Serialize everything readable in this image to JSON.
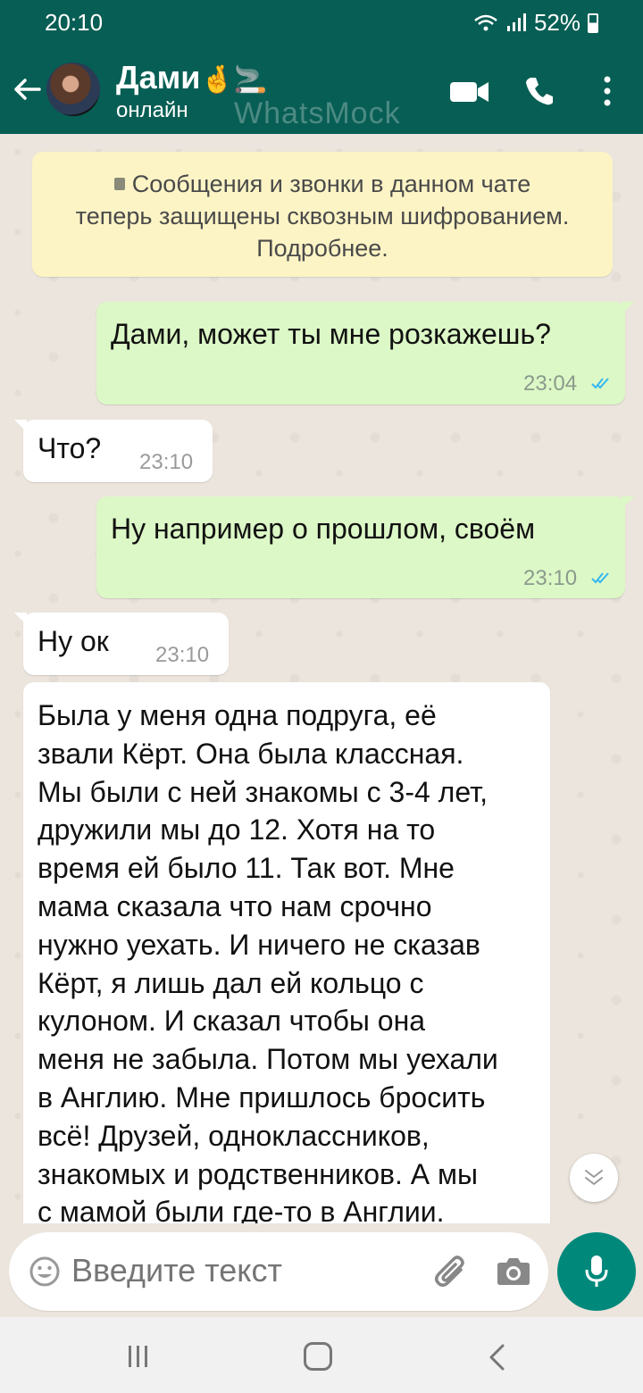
{
  "status_bar": {
    "time": "20:10",
    "battery": "52%"
  },
  "header": {
    "contact_name": "Дами",
    "contact_emoji": "🤞🚬",
    "contact_status": "онлайн",
    "watermark": "WhatsMock"
  },
  "system_message": {
    "line1": "Сообщения и звонки в данном чате",
    "line2": "теперь защищены сквозным шифрованием.",
    "line3": "Подробнее."
  },
  "messages": [
    {
      "direction": "out",
      "text": "Дами, может ты мне розкажешь?",
      "time": "23:04",
      "read": true
    },
    {
      "direction": "in",
      "text": "Что?",
      "time": "23:10"
    },
    {
      "direction": "out",
      "text": "Ну например о прошлом, своём",
      "time": "23:10",
      "read": true
    },
    {
      "direction": "in",
      "text": "Ну ок",
      "time": "23:10"
    },
    {
      "direction": "in",
      "lines": [
        "Была у меня одна подруга, её",
        "звали Кёрт. Она была классная.",
        "Мы были с ней знакомы с 3-4 лет,",
        "дружили мы до 12. Хотя на то",
        "время ей было 11. Так вот. Мне",
        "мама сказала что нам срочно",
        "нужно уехать. И ничего не сказав",
        "Кёрт, я лишь дал ей кольцо с",
        "кулоном. И сказал чтобы она",
        "меня не забыла. Потом мы уехали",
        "в Англию. Мне пришлось бросить",
        "всё! Друзей, одноклассников,",
        "знакомых и родственников. А мы",
        "с мамой были где-то в Англии."
      ]
    }
  ],
  "input": {
    "placeholder": "Введите текст"
  },
  "colors": {
    "header": "#075e54",
    "outgoing": "#dcf8c6",
    "incoming": "#ffffff",
    "accent": "#00897b",
    "read_ticks": "#34b7f1"
  }
}
